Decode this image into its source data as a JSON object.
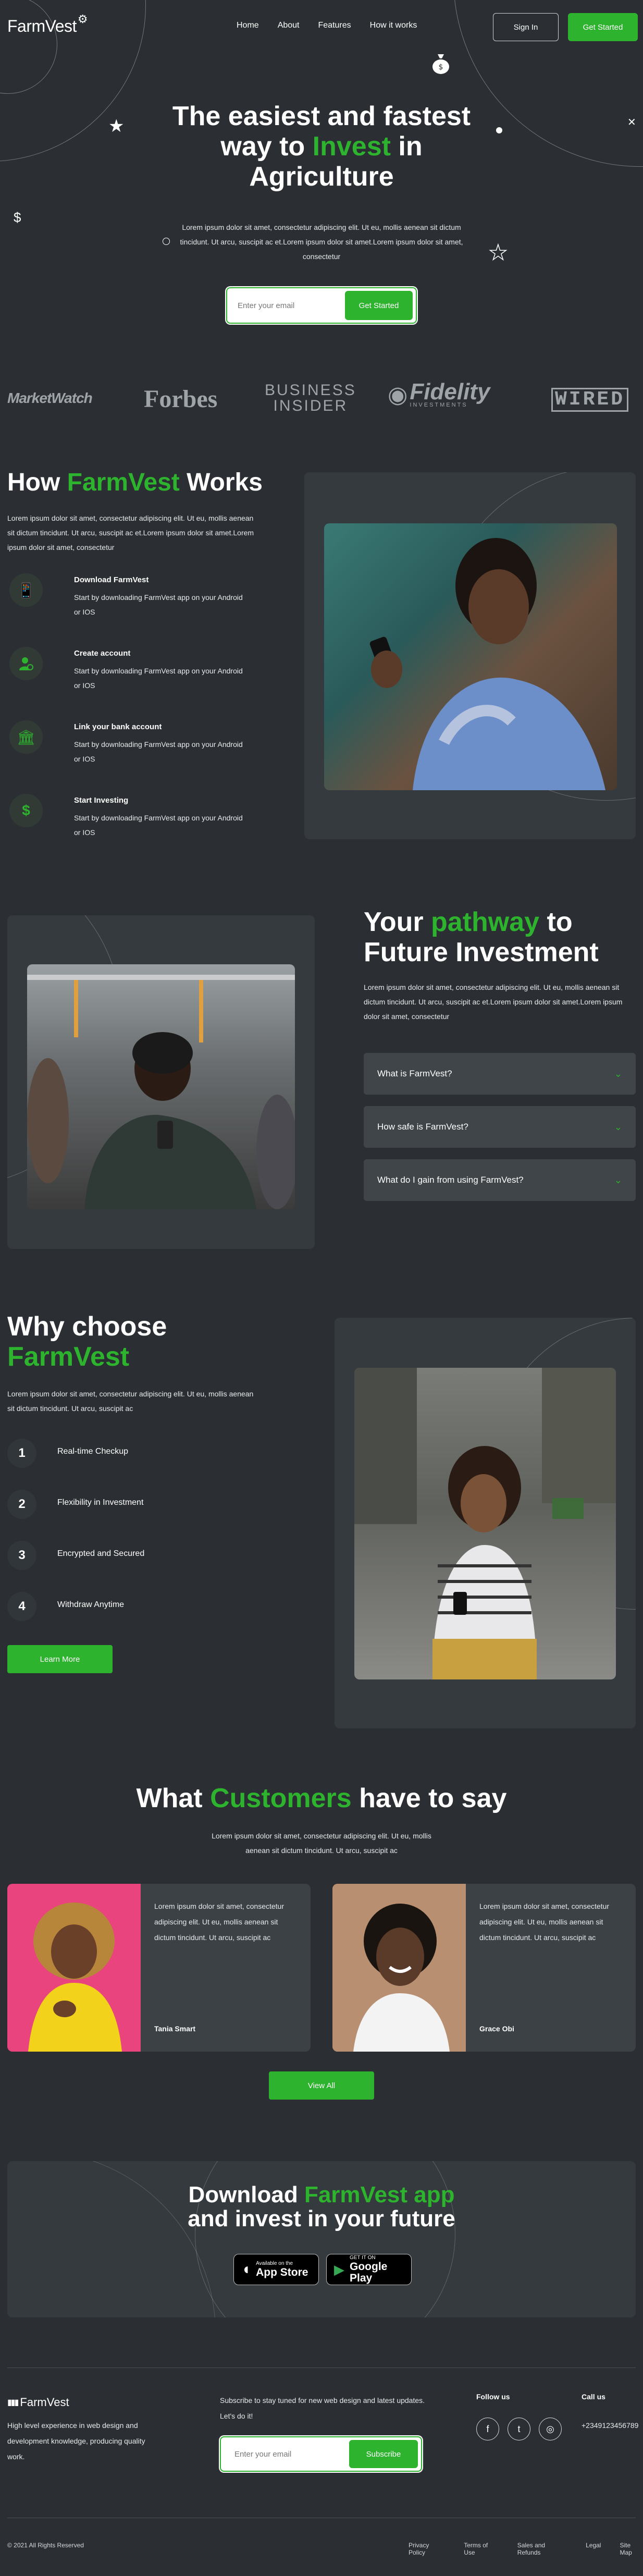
{
  "header": {
    "logo": "FarmVest",
    "nav": [
      "Home",
      "About",
      "Features",
      "How it works"
    ],
    "signin_label": "Sign In",
    "getstarted_label": "Get Started"
  },
  "hero": {
    "title_pre": "The easiest and fastest way to ",
    "title_accent": "Invest",
    "title_post": " in Agriculture",
    "description": "Lorem ipsum dolor sit amet, consectetur adipiscing elit. Ut eu, mollis aenean sit dictum tincidunt. Ut arcu, suscipit ac et.Lorem ipsum dolor sit amet.Lorem ipsum dolor sit amet, consectetur",
    "email_placeholder": "Enter your email",
    "cta_label": "Get Started"
  },
  "logos": [
    "MarketWatch",
    "Forbes",
    "BUSINESS",
    "INSIDER",
    "Fidelity",
    "INVESTMENTS",
    "WIRED"
  ],
  "how": {
    "title_pre": "How ",
    "title_accent": "FarmVest",
    "title_post": " Works",
    "description": "Lorem ipsum dolor sit amet, consectetur adipiscing elit. Ut eu, mollis aenean sit dictum tincidunt. Ut arcu, suscipit ac et.Lorem ipsum dolor sit amet.Lorem ipsum dolor sit amet, consectetur",
    "steps": [
      {
        "title": "Download FarmVest",
        "desc": "Start by downloading FarmVest app on your Android or IOS"
      },
      {
        "title": "Create account",
        "desc": "Start by downloading FarmVest app on your Android or IOS"
      },
      {
        "title": "Link your bank account",
        "desc": "Start by downloading FarmVest app on your Android or IOS"
      },
      {
        "title": "Start Investing",
        "desc": "Start by downloading FarmVest app on your Android or IOS"
      }
    ]
  },
  "pathway": {
    "title_pre": "Your ",
    "title_accent": "pathway",
    "title_post": " to Future Investment",
    "description": "Lorem ipsum dolor sit amet, consectetur adipiscing elit. Ut eu, mollis aenean sit dictum tincidunt. Ut arcu, suscipit ac et.Lorem ipsum dolor sit amet.Lorem ipsum dolor sit amet, consectetur",
    "faqs": [
      "What is FarmVest?",
      "How safe is FarmVest?",
      "What do I gain from using FarmVest?"
    ]
  },
  "why": {
    "title_pre": "Why choose",
    "title_accent": "FarmVest",
    "description": "Lorem ipsum dolor sit amet, consectetur adipiscing elit. Ut eu, mollis aenean sit dictum tincidunt. Ut arcu, suscipit ac",
    "items": [
      {
        "num": "1",
        "label": "Real-time Checkup"
      },
      {
        "num": "2",
        "label": "Flexibility in Investment"
      },
      {
        "num": "3",
        "label": "Encrypted and Secured"
      },
      {
        "num": "4",
        "label": "Withdraw Anytime"
      }
    ],
    "learn_label": "Learn More"
  },
  "testimonials": {
    "title_pre": "What ",
    "title_accent": "Customers",
    "title_post": " have to say",
    "description": "Lorem ipsum dolor sit amet, consectetur adipiscing elit. Ut eu, mollis aenean sit dictum tincidunt. Ut arcu, suscipit ac",
    "cards": [
      {
        "text": "Lorem ipsum dolor sit amet, consectetur adipiscing elit. Ut eu, mollis aenean sit dictum tincidunt. Ut arcu, suscipit ac",
        "name": "Tania Smart"
      },
      {
        "text": "Lorem ipsum dolor sit amet, consectetur adipiscing elit. Ut eu, mollis aenean sit dictum tincidunt. Ut arcu, suscipit ac",
        "name": "Grace Obi"
      }
    ],
    "viewall_label": "View All"
  },
  "download": {
    "title_pre": "Download ",
    "title_accent": "FarmVest app",
    "title_post": "and invest in your future",
    "appstore_small": "Available on the",
    "appstore_big": "App Store",
    "googleplay_small": "GET IT ON",
    "googleplay_big": "Google Play"
  },
  "footer": {
    "logo": "FarmVest",
    "desc": "High level experience in web design and development knowledge, producing quality work.",
    "subscribe_text": "Subscribe to stay tuned for new web design and latest updates. Let's do it!",
    "email_placeholder": "Enter your email",
    "subscribe_label": "Subscribe",
    "follow_title": "Follow us",
    "call_title": "Call us",
    "phone": "+2349123456789",
    "copyright": "© 2021 All Rights Reserved",
    "links": [
      "Privacy Policy",
      "Terms of Use",
      "Sales and Refunds",
      "Legal",
      "Site Map"
    ]
  },
  "colors": {
    "background": "#2b2f33",
    "accent": "#2db32d",
    "panel": "#353a3e"
  }
}
